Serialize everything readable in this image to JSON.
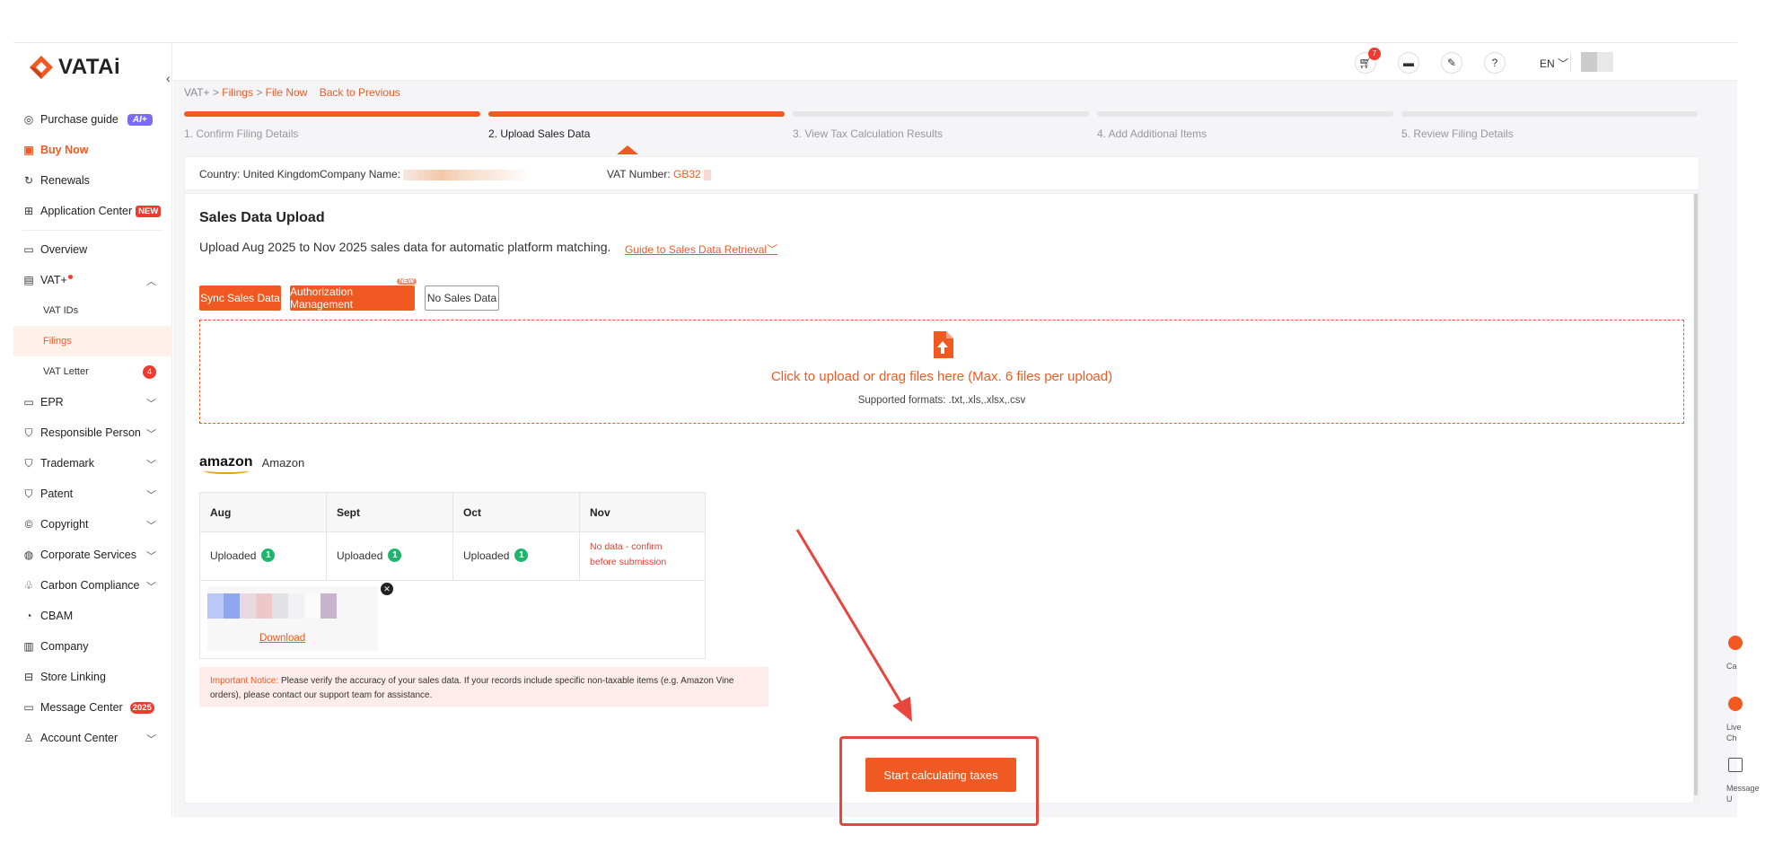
{
  "brand": {
    "name": "VATAi",
    "accent": "#f05a22"
  },
  "sidebar": {
    "items": [
      {
        "label": "Purchase guide",
        "icon": "compass-icon",
        "badge": "AI+"
      },
      {
        "label": "Buy Now",
        "icon": "bag-icon"
      },
      {
        "label": "Renewals",
        "icon": "refresh-icon"
      },
      {
        "label": "Application Center",
        "icon": "apps-icon",
        "badge": "NEW"
      },
      {
        "label": "Overview",
        "icon": "monitor-icon"
      },
      {
        "label": "VAT+",
        "icon": "vat-icon"
      },
      {
        "label": "VAT IDs"
      },
      {
        "label": "Filings"
      },
      {
        "label": "VAT Letter",
        "badge": "4"
      },
      {
        "label": "EPR",
        "icon": "epr-icon"
      },
      {
        "label": "Responsible Person",
        "icon": "shield-icon"
      },
      {
        "label": "Trademark",
        "icon": "trademark-icon"
      },
      {
        "label": "Patent",
        "icon": "patent-icon"
      },
      {
        "label": "Copyright",
        "icon": "copyright-icon"
      },
      {
        "label": "Corporate Services",
        "icon": "globe-icon"
      },
      {
        "label": "Carbon Compliance",
        "icon": "leaf-icon"
      },
      {
        "label": "CBAM",
        "icon": "cbam-icon"
      },
      {
        "label": "Company",
        "icon": "building-icon"
      },
      {
        "label": "Store Linking",
        "icon": "store-icon"
      },
      {
        "label": "Message Center",
        "icon": "message-icon",
        "badge": "2025"
      },
      {
        "label": "Account Center",
        "icon": "user-icon"
      }
    ]
  },
  "topbar": {
    "cart_count": "7",
    "language": "EN"
  },
  "breadcrumb": {
    "root": "VAT+",
    "sep": ">",
    "filings": "Filings",
    "file_now": "File Now",
    "back": "Back to Previous"
  },
  "steps": [
    "1. Confirm Filing Details",
    "2. Upload Sales Data",
    "3. View Tax Calculation Results",
    "4. Add Additional Items",
    "5. Review Filing Details"
  ],
  "info": {
    "country": "Country: United Kingdom",
    "company_label": "Company Name:",
    "vat_label": "VAT Number:",
    "vat_value": "GB32"
  },
  "upload": {
    "title": "Sales Data Upload",
    "description": "Upload Aug 2025 to Nov 2025 sales data for automatic platform matching.",
    "guide_link": "Guide to Sales Data Retrieval",
    "sync_button": "Sync Sales Data",
    "auth_button": "Authorization Management",
    "auth_tag": "NEW",
    "no_sales_button": "No Sales Data",
    "drop_text": "Click to upload or drag files here (Max. 6 files per upload)",
    "formats": "Supported formats: .txt,.xls,.xlsx,.csv"
  },
  "amazon": {
    "logo": "amazon",
    "label": "Amazon",
    "months": [
      "Aug",
      "Sept",
      "Oct",
      "Nov"
    ],
    "status": [
      "Uploaded",
      "Uploaded",
      "Uploaded",
      "No data - confirm before submission"
    ],
    "counts": [
      "1",
      "1",
      "1"
    ],
    "download": "Download"
  },
  "notice": {
    "label": "Important Notice:",
    "text": "Please verify the accuracy of your sales data. If your records include specific non-taxable items (e.g. Amazon Vine orders), please contact our support team for assistance."
  },
  "actions": {
    "calculate": "Start calculating taxes"
  },
  "floating": [
    "Ca",
    "Live Ch",
    "Message U"
  ]
}
